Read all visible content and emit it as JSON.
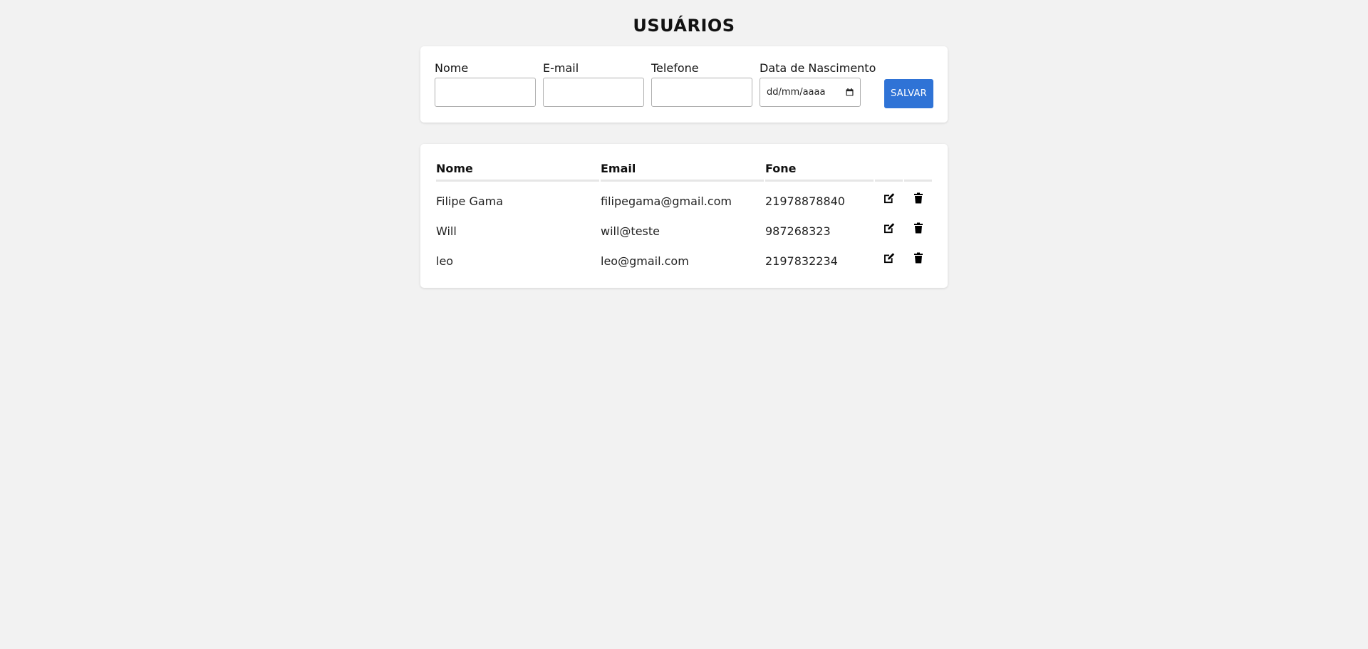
{
  "page": {
    "title": "USUÁRIOS"
  },
  "form": {
    "fields": [
      {
        "label": "Nome",
        "value": "",
        "placeholder": ""
      },
      {
        "label": "E-mail",
        "value": "",
        "placeholder": ""
      },
      {
        "label": "Telefone",
        "value": "",
        "placeholder": ""
      },
      {
        "label": "Data de Nascimento",
        "value": "dd/mm/aaaa"
      }
    ],
    "save_label": "SALVAR"
  },
  "table": {
    "headers": [
      "Nome",
      "Email",
      "Fone"
    ],
    "rows": [
      {
        "nome": "Filipe Gama",
        "email": "filipegama@gmail.com",
        "fone": "21978878840"
      },
      {
        "nome": "Will",
        "email": "will@teste",
        "fone": "987268323"
      },
      {
        "nome": "leo",
        "email": "leo@gmail.com",
        "fone": "2197832234"
      }
    ]
  },
  "icons": {
    "edit": "edit-icon",
    "delete": "trash-icon",
    "calendar": "calendar-icon"
  },
  "colors": {
    "accent": "#2f73d6",
    "background": "#f2f2f2",
    "card": "#ffffff"
  }
}
